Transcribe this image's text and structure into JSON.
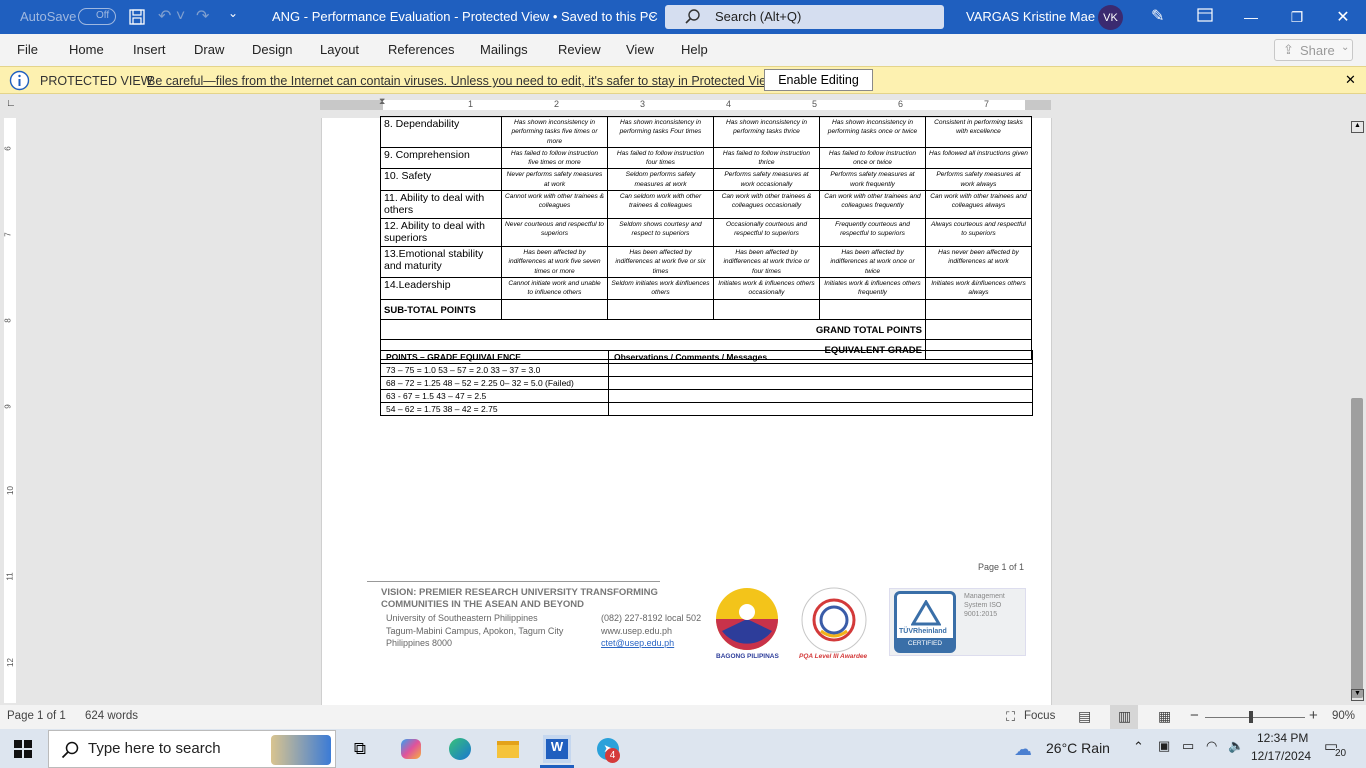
{
  "titlebar": {
    "autosave_label": "AutoSave",
    "autosave_state": "Off",
    "doc_title": "ANG - Performance Evaluation  -  Protected View • Saved to this PC",
    "search_placeholder": "Search (Alt+Q)",
    "user_name": "VARGAS Kristine Mae L.",
    "user_initials": "VK"
  },
  "menu": [
    "File",
    "Home",
    "Insert",
    "Draw",
    "Design",
    "Layout",
    "References",
    "Mailings",
    "Review",
    "View",
    "Help"
  ],
  "share_label": "Share",
  "protected": {
    "title": "PROTECTED VIEW",
    "message": "Be careful—files from the Internet can contain viruses. Unless you need to edit, it's safer to stay in Protected View.",
    "button": "Enable Editing"
  },
  "ruler_numbers": [
    "1",
    "2",
    "3",
    "4",
    "5",
    "6",
    "7"
  ],
  "vruler_numbers": [
    "6",
    "7",
    "8",
    "9",
    "10",
    "11",
    "12"
  ],
  "evaluation": {
    "rows": [
      {
        "crit": "8. Dependability",
        "d": [
          "Has shown inconsistency in performing tasks five times or more",
          "Has shown inconsistency in performing tasks Four times",
          "Has shown inconsistency in performing tasks thrice",
          "Has shown inconsistency in performing tasks once or twice",
          "Consistent in performing tasks with excellence"
        ]
      },
      {
        "crit": "9. Comprehension",
        "d": [
          "Has failed to follow instruction five times or more",
          "Has failed to follow instruction four times",
          "Has failed to follow instruction thrice",
          "Has failed to follow instruction once or twice",
          "Has followed all instructions given"
        ]
      },
      {
        "crit": "10.  Safety",
        "d": [
          "Never performs safety measures at work",
          "Seldom performs safety measures at work",
          "Performs safety measures at work occasionally",
          "Performs safety measures at work frequently",
          "Performs safety measures at work always"
        ]
      },
      {
        "crit": "11. Ability to deal with others",
        "d": [
          "Cannot work with other trainees & colleagues",
          "Can seldom work with other trainees & colleagues",
          "Can work with other trainees & colleagues occasionally",
          "Can work with other trainees and colleagues frequently",
          "Can work with other trainees and colleagues always"
        ]
      },
      {
        "crit": "12. Ability to deal with superiors",
        "d": [
          "Never courteous and respectful to superiors",
          "Seldom shows courtesy and respect to superiors",
          "Occasionally courteous and respectful to superiors",
          "Frequently courteous and respectful to superiors",
          "Always courteous and respectful to superiors"
        ]
      },
      {
        "crit": "13.Emotional  stability and maturity",
        "d": [
          "Has  been affected by indifferences at work five seven times or more",
          "Has been affected by indifferences at work five or six times",
          "Has been  affected by indifferences at work thrice or four times",
          "Has been affected by indifferences at work once or twice",
          "Has never been affected by indifferences at work"
        ]
      },
      {
        "crit": "14.Leadership",
        "d": [
          "Cannot initiate work and unable to influence others",
          "Seldom initiates work &influences others",
          "Initiates work & influences others occasionally",
          "Initiates work & influences others  frequently",
          "Initiates work &influences others  always"
        ]
      }
    ],
    "subtotal": "SUB-TOTAL POINTS",
    "grand_total": "GRAND TOTAL POINTS",
    "equiv_grade": "EQUIVALENT GRADE"
  },
  "grades": {
    "header_left": "POINTS – GRADE EQUIVALENCE",
    "header_right": "Observations / Comments / Messages",
    "rows": [
      "73 – 75 = 1.0        53 – 57 = 2.0        33 – 37 = 3.0",
      "68 – 72 = 1.25      48 – 52 = 2.25     0– 32 = 5.0 (Failed)",
      "63 - 67 = 1.5        43 – 47 = 2.5",
      "54 – 62 = 1.75     38 – 42 = 2.75"
    ]
  },
  "footer": {
    "page_label": "Page 1 of 1",
    "vision": "VISION: PREMIER RESEARCH UNIVERSITY TRANSFORMING COMMUNITIES IN THE ASEAN AND BEYOND",
    "addr1": "University of Southeastern Philippines",
    "addr2": "Tagum-Mabini Campus, Apokon, Tagum City",
    "addr3": "Philippines 8000",
    "phone": "(082) 227-8192 local 502",
    "web": "www.usep.edu.ph",
    "email": "ctet@usep.edu.ph",
    "logo1": "BAGONG PILIPINAS",
    "logo2": "PQA Level III Awardee",
    "logo3": "TÜVRheinland",
    "logo3b": "CERTIFIED",
    "logo3c": "Management System ISO 9001:2015"
  },
  "status": {
    "page": "Page 1 of 1",
    "words": "624 words",
    "focus": "Focus",
    "zoom": "90%"
  },
  "taskbar": {
    "search": "Type here to search",
    "weather": "26°C  Rain",
    "time": "12:34 PM",
    "date": "12/17/2024",
    "notif": "20",
    "telegram_badge": "4"
  }
}
